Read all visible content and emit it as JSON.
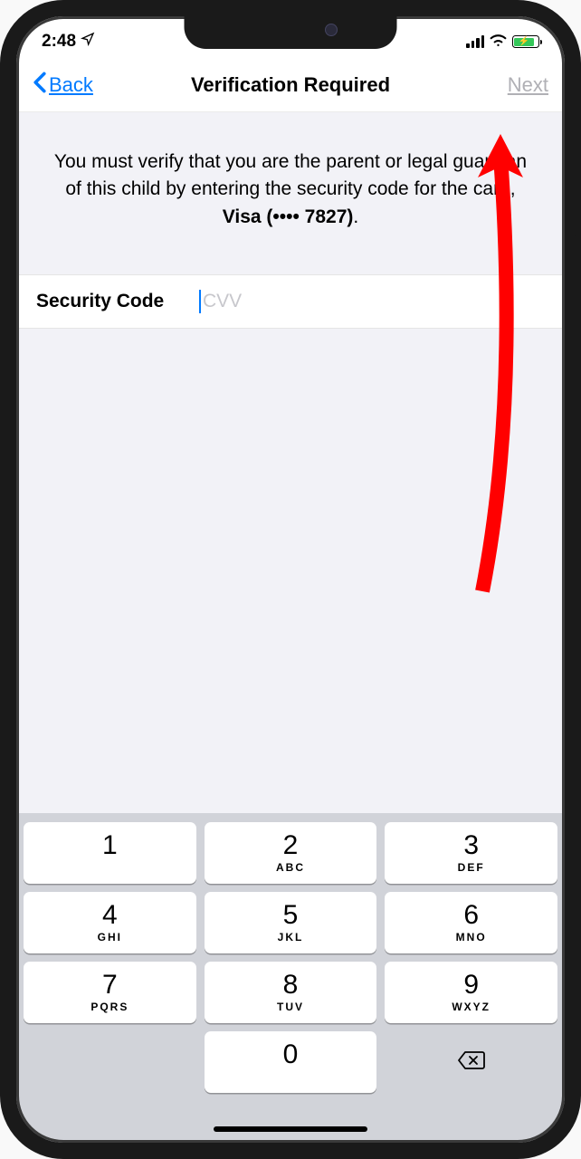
{
  "status": {
    "time": "2:48"
  },
  "nav": {
    "back_label": "Back",
    "title": "Verification Required",
    "next_label": "Next"
  },
  "instruction": {
    "text_prefix": "You must verify that you are the parent or legal guardian of this child by entering the security code for the card, ",
    "card": "Visa (•••• 7827)",
    "text_suffix": "."
  },
  "security": {
    "label": "Security Code",
    "placeholder": "CVV",
    "value": ""
  },
  "keypad": {
    "keys": [
      {
        "num": "1",
        "letters": ""
      },
      {
        "num": "2",
        "letters": "ABC"
      },
      {
        "num": "3",
        "letters": "DEF"
      },
      {
        "num": "4",
        "letters": "GHI"
      },
      {
        "num": "5",
        "letters": "JKL"
      },
      {
        "num": "6",
        "letters": "MNO"
      },
      {
        "num": "7",
        "letters": "PQRS"
      },
      {
        "num": "8",
        "letters": "TUV"
      },
      {
        "num": "9",
        "letters": "WXYZ"
      },
      {
        "num": "0",
        "letters": ""
      }
    ]
  }
}
